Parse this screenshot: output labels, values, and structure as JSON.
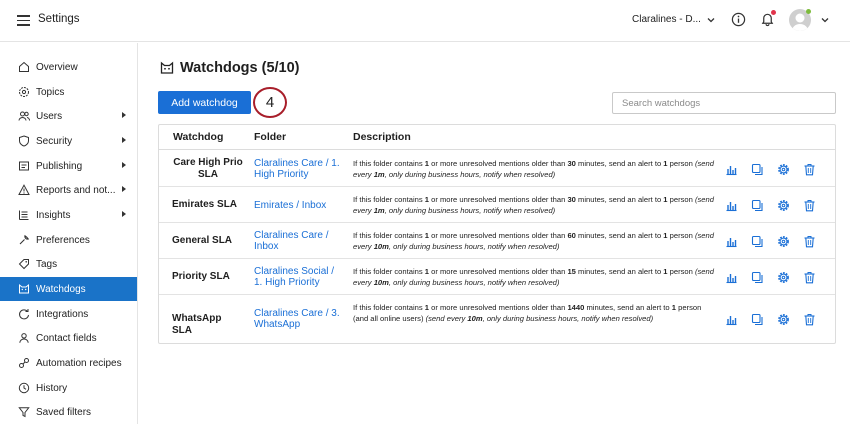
{
  "header": {
    "app_title": "Settings",
    "account_name": "Claralines - D...",
    "icons": [
      "menu-icon",
      "info-icon",
      "bell-icon",
      "avatar",
      "chevron-down-icon"
    ],
    "notification_color": "#e0344b",
    "presence_color": "#7dbb3c"
  },
  "sidebar": {
    "items": [
      {
        "label": "Overview",
        "icon": "home-icon",
        "has_submenu": false
      },
      {
        "label": "Topics",
        "icon": "gear-icon",
        "has_submenu": false
      },
      {
        "label": "Users",
        "icon": "users-icon",
        "has_submenu": true
      },
      {
        "label": "Security",
        "icon": "shield-icon",
        "has_submenu": true
      },
      {
        "label": "Publishing",
        "icon": "publish-icon",
        "has_submenu": true
      },
      {
        "label": "Reports and not...",
        "icon": "warning-icon",
        "has_submenu": true
      },
      {
        "label": "Insights",
        "icon": "insights-icon",
        "has_submenu": true
      },
      {
        "label": "Preferences",
        "icon": "wrench-icon",
        "has_submenu": false
      },
      {
        "label": "Tags",
        "icon": "tag-icon",
        "has_submenu": false
      },
      {
        "label": "Watchdogs",
        "icon": "watchdog-icon",
        "has_submenu": false,
        "active": true
      },
      {
        "label": "Integrations",
        "icon": "integrations-icon",
        "has_submenu": false
      },
      {
        "label": "Contact fields",
        "icon": "person-icon",
        "has_submenu": false
      },
      {
        "label": "Automation recipes",
        "icon": "automation-icon",
        "has_submenu": false
      },
      {
        "label": "History",
        "icon": "history-icon",
        "has_submenu": false
      },
      {
        "label": "Saved filters",
        "icon": "filter-icon",
        "has_submenu": false
      }
    ],
    "active_color": "#1a73c8"
  },
  "main": {
    "title": "Watchdogs (5/10)",
    "add_button_label": "Add watchdog",
    "step_badge": "4",
    "search_placeholder": "Search watchdogs",
    "columns": {
      "watchdog": "Watchdog",
      "folder": "Folder",
      "description": "Description"
    },
    "rows": [
      {
        "name": "Care High Prio SLA",
        "folder": "Claralines Care / 1. High Priority",
        "desc": {
          "pre": "If this folder contains ",
          "count": "1",
          "mid1": " or more unresolved mentions older than ",
          "age": "30",
          "mid2": " minutes, send an alert to ",
          "people": "1",
          "post": " person ",
          "freq_pre": "(send every ",
          "freq": "1m",
          "freq_post": ", only during business hours, notify when resolved)"
        }
      },
      {
        "name": "Emirates SLA",
        "folder": "Emirates / Inbox",
        "desc": {
          "pre": "If this folder contains ",
          "count": "1",
          "mid1": " or more unresolved mentions older than ",
          "age": "30",
          "mid2": " minutes, send an alert to ",
          "people": "1",
          "post": " person ",
          "freq_pre": "(send every ",
          "freq": "1m",
          "freq_post": ", only during business hours, notify when resolved)"
        }
      },
      {
        "name": "General SLA",
        "folder": "Claralines Care / Inbox",
        "desc": {
          "pre": "If this folder contains ",
          "count": "1",
          "mid1": " or more unresolved mentions older than ",
          "age": "60",
          "mid2": " minutes, send an alert to ",
          "people": "1",
          "post": " person ",
          "freq_pre": "(send every ",
          "freq": "10m",
          "freq_post": ", only during business hours, notify when resolved)"
        }
      },
      {
        "name": "Priority SLA",
        "folder": "Claralines Social / 1. High Priority",
        "desc": {
          "pre": "If this folder contains ",
          "count": "1",
          "mid1": " or more unresolved mentions older than ",
          "age": "15",
          "mid2": " minutes, send an alert to ",
          "people": "1",
          "post": " person ",
          "freq_pre": "(send every ",
          "freq": "10m",
          "freq_post": ", only during business hours, notify when resolved)"
        }
      },
      {
        "name": "WhatsApp SLA",
        "folder": "Claralines Care / 3. WhatsApp",
        "desc": {
          "pre": "If this folder contains ",
          "count": "1",
          "mid1": " or more unresolved mentions older than ",
          "age": "1440",
          "mid2": " minutes, send an alert to ",
          "people": "1",
          "post": " person (and all online users) ",
          "freq_pre": "(send every ",
          "freq": "10m",
          "freq_post": ", only during business hours, notify when resolved)"
        }
      }
    ],
    "row_actions": [
      "stats-icon",
      "copy-icon",
      "gear-icon",
      "trash-icon"
    ],
    "accent_color": "#1a6fd6",
    "badge_color": "#a81e2a"
  }
}
